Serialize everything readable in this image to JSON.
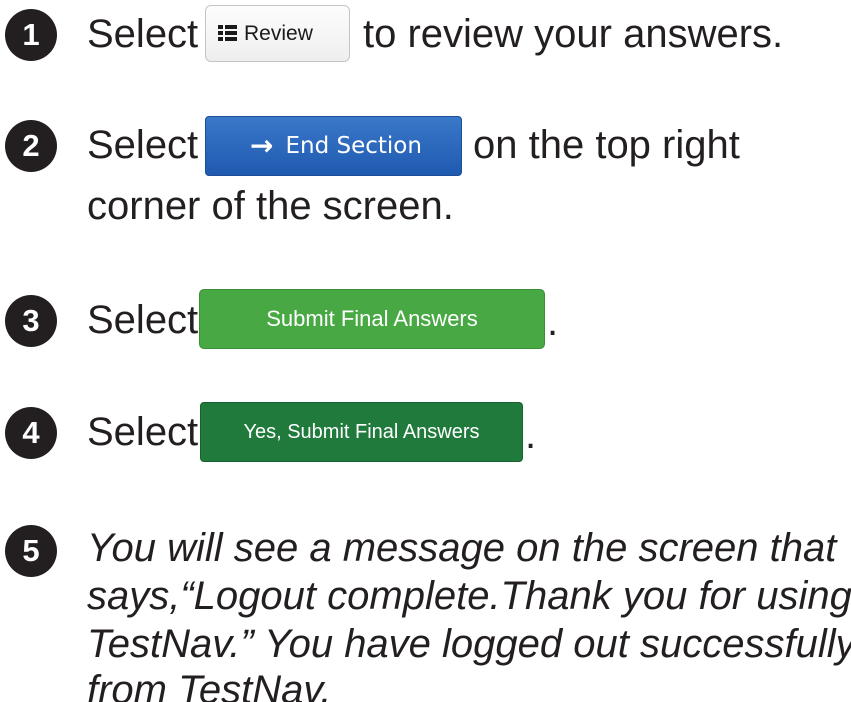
{
  "steps": [
    {
      "number": "1",
      "before": "Select",
      "after": "to review your answers."
    },
    {
      "number": "2",
      "before": "Select",
      "after": "on the top right",
      "line2": "corner of the screen."
    },
    {
      "number": "3",
      "before": "Select",
      "after": "."
    },
    {
      "number": "4",
      "before": "Select",
      "after": "."
    },
    {
      "number": "5",
      "lines": [
        "You will see a message on the screen that",
        "says,“Logout complete.Thank you for using",
        "TestNav.” You have logged out successfully",
        "from TestNav."
      ]
    }
  ],
  "buttons": {
    "review": {
      "label": "Review",
      "icon": "list-icon"
    },
    "end_section": {
      "label": "End Section",
      "icon": "arrow-right-icon",
      "color": "#2a66bd"
    },
    "submit": {
      "label": "Submit Final Answers",
      "color": "#48a843"
    },
    "yes_submit": {
      "label": "Yes, Submit Final Answers",
      "color": "#1f7a3c"
    }
  }
}
